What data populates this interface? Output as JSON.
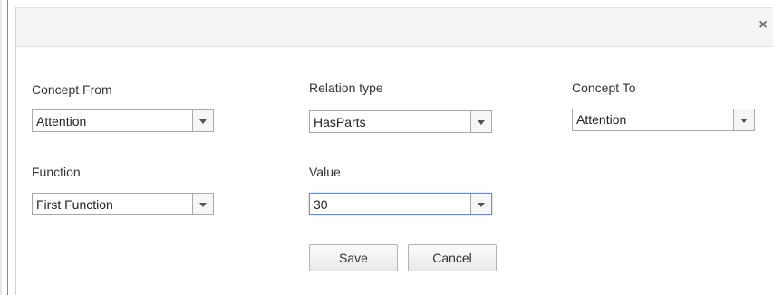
{
  "dialog": {
    "close_glyph": "×",
    "concept_from": {
      "label": "Concept From",
      "value": "Attention"
    },
    "relation_type": {
      "label": "Relation type",
      "value": "HasParts"
    },
    "concept_to": {
      "label": "Concept To",
      "value": "Attention"
    },
    "function": {
      "label": "Function",
      "value": "First Function"
    },
    "value_field": {
      "label": "Value",
      "value": "30"
    },
    "save_label": "Save",
    "cancel_label": "Cancel"
  },
  "colors": {
    "header_bg": "#f4f4f4",
    "border": "#a9a9a9",
    "focus_border": "#6a8fc4"
  },
  "icons": [
    "close-icon",
    "chevron-down-icon"
  ]
}
